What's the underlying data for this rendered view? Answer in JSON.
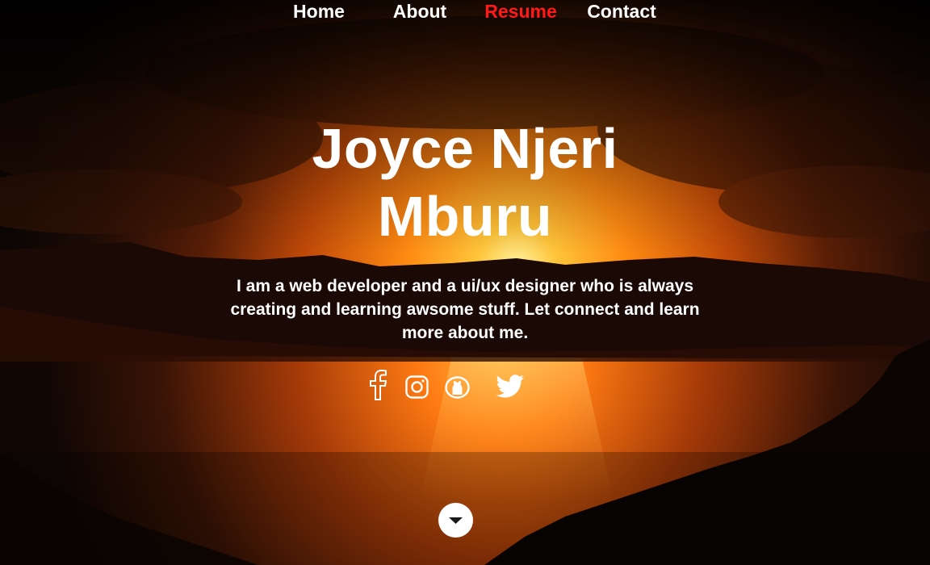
{
  "nav": {
    "items": [
      {
        "label": "Home",
        "active": false
      },
      {
        "label": "About",
        "active": false
      },
      {
        "label": "Resume",
        "active": true
      },
      {
        "label": "Contact",
        "active": false
      }
    ],
    "active_color": "#ff1a1a"
  },
  "hero": {
    "name_line1": "Joyce Njeri",
    "name_line2": "Mburu",
    "tagline_line1": "I am a web developer and a ui/ux designer who is always",
    "tagline_line2": "creating and learning awsome stuff. Let connect and learn",
    "tagline_line3": "more about me."
  },
  "social": [
    {
      "icon": "facebook-icon"
    },
    {
      "icon": "instagram-icon"
    },
    {
      "icon": "github-icon"
    },
    {
      "icon": "twitter-icon"
    }
  ],
  "scroll_down": {
    "icon": "chevron-down-icon"
  },
  "colors": {
    "text": "#ffffff",
    "accent": "#ff1a1a",
    "sky_glow": "#ff8a1a"
  }
}
